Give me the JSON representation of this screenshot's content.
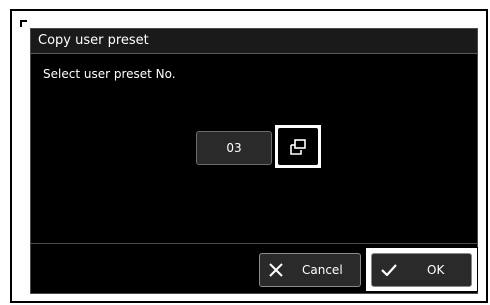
{
  "dialog": {
    "title": "Copy user preset",
    "prompt": "Select user preset No."
  },
  "preset_field": {
    "value": "03",
    "select_icon": "select-list-icon"
  },
  "buttons": {
    "cancel_label": "Cancel",
    "cancel_icon": "close-icon",
    "ok_label": "OK",
    "ok_icon": "checkmark-icon"
  },
  "colors": {
    "dialog_background": "#000000",
    "text": "#ffffff",
    "highlight_frame": "#ffffff",
    "button_background": "#2a2a2a"
  }
}
